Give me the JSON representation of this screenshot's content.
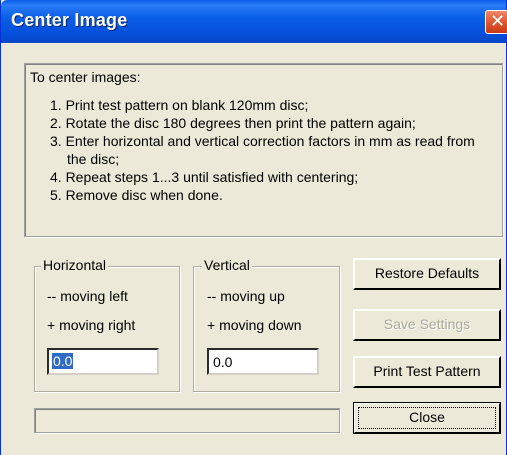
{
  "window": {
    "title": "Center Image",
    "close_glyph": "✕"
  },
  "instructions": {
    "intro": "To center images:",
    "steps": [
      "1. Print test pattern on blank 120mm disc;",
      "2. Rotate the disc 180 degrees then print the pattern again;",
      "3. Enter horizontal and vertical correction factors in mm as read from the disc;",
      "4. Repeat steps 1...3 until satisfied with centering;",
      "5. Remove disc when done."
    ]
  },
  "horizontal": {
    "legend": "Horizontal",
    "hint_negative": "-- moving left",
    "hint_positive": "+ moving right",
    "value": "0.0"
  },
  "vertical": {
    "legend": "Vertical",
    "hint_negative": "-- moving up",
    "hint_positive": "+ moving down",
    "value": "0.0"
  },
  "buttons": {
    "restore_defaults": "Restore Defaults",
    "save_settings": "Save Settings",
    "print_test_pattern": "Print Test Pattern",
    "close": "Close"
  },
  "status_text": "",
  "colors": {
    "titlebar": "#0550dc",
    "dialog_bg": "#ece9d8",
    "selection": "#316ac5",
    "disabled_text": "#aca899"
  }
}
